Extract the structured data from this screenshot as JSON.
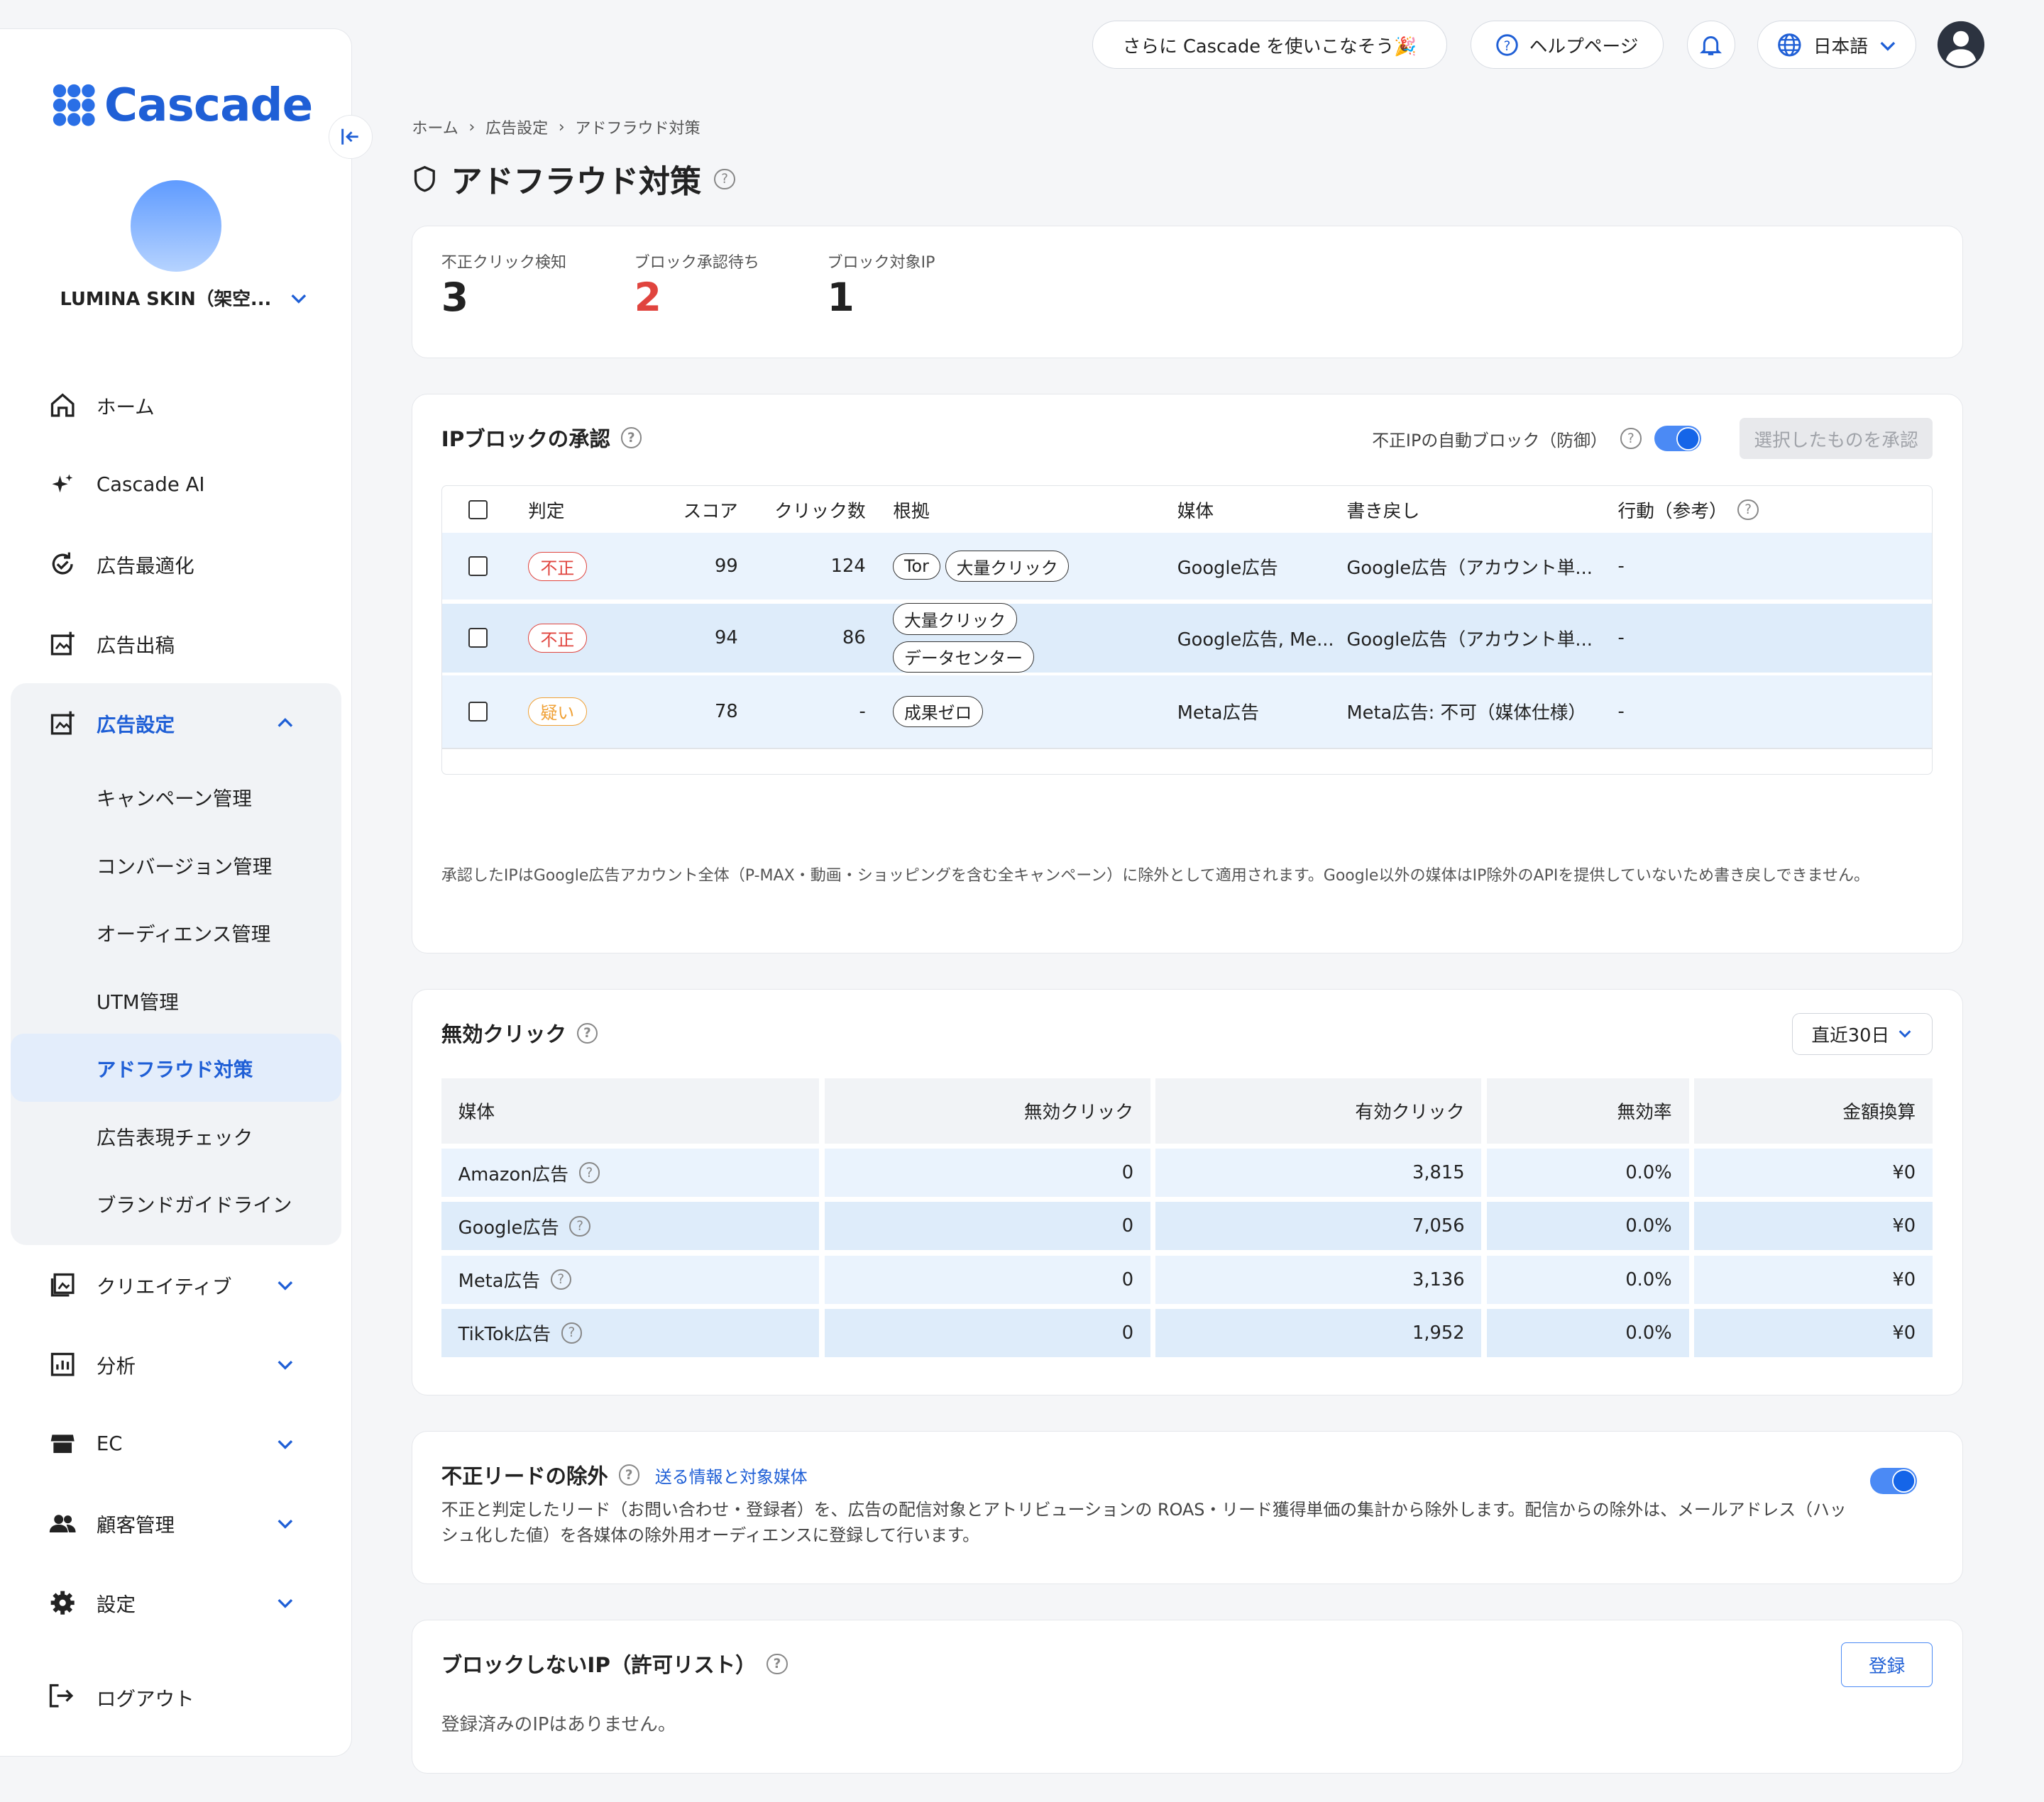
{
  "brand": {
    "name": "Cascade",
    "accent": "#1f5fd6"
  },
  "account": {
    "name": "LUMINA SKIN（架空..."
  },
  "topbar": {
    "promo": "さらに Cascade を使いこなそう🎉",
    "help": "ヘルプページ",
    "language": "日本語"
  },
  "nav": {
    "home": "ホーム",
    "ai": "Cascade AI",
    "optimize": "広告最適化",
    "publish": "広告出稿",
    "settings_group": "広告設定",
    "sub": [
      "キャンペーン管理",
      "コンバージョン管理",
      "オーディエンス管理",
      "UTM管理",
      "アドフラウド対策",
      "広告表現チェック",
      "ブランドガイドライン"
    ],
    "creative": "クリエイティブ",
    "analysis": "分析",
    "ec": "EC",
    "customers": "顧客管理",
    "settings": "設定",
    "logout": "ログアウト"
  },
  "breadcrumb": [
    "ホーム",
    "広告設定",
    "アドフラウド対策"
  ],
  "page_title": "アドフラウド対策",
  "stats": [
    {
      "label": "不正クリック検知",
      "value": "3",
      "color": "#222222"
    },
    {
      "label": "ブロック承認待ち",
      "value": "2",
      "color": "#e0443e"
    },
    {
      "label": "ブロック対象IP",
      "value": "1",
      "color": "#222222"
    }
  ],
  "ip_block": {
    "title": "IPブロックの承認",
    "auto_block_label": "不正IPの自動ブロック（防御）",
    "approve_button": "選択したものを承認",
    "columns": [
      "判定",
      "スコア",
      "クリック数",
      "根拠",
      "媒体",
      "書き戻し",
      "行動（参考）"
    ],
    "rows": [
      {
        "verdict": "不正",
        "verdict_type": "bad",
        "score": "99",
        "clicks": "124",
        "reasons": [
          "Tor",
          "大量クリック"
        ],
        "media": "Google広告",
        "writeback": "Google広告（アカウント単...",
        "action": "-"
      },
      {
        "verdict": "不正",
        "verdict_type": "bad",
        "score": "94",
        "clicks": "86",
        "reasons": [
          "大量クリック",
          "データセンター"
        ],
        "media": "Google広告, Me...",
        "writeback": "Google広告（アカウント単...",
        "action": "-"
      },
      {
        "verdict": "疑い",
        "verdict_type": "sus",
        "score": "78",
        "clicks": "-",
        "reasons": [
          "成果ゼロ"
        ],
        "media": "Meta広告",
        "writeback": "Meta広告: 不可（媒体仕様）",
        "action": "-"
      }
    ],
    "note": "承認したIPはGoogle広告アカウント全体（P-MAX・動画・ショッピングを含む全キャンペーン）に除外として適用されます。Google以外の媒体はIP除外のAPIを提供していないため書き戻しできません。"
  },
  "invalid_clicks": {
    "title": "無効クリック",
    "period": "直近30日",
    "columns": [
      "媒体",
      "無効クリック",
      "有効クリック",
      "無効率",
      "金額換算"
    ],
    "rows": [
      {
        "media": "Amazon広告",
        "invalid": "0",
        "valid": "3,815",
        "rate": "0.0%",
        "amount": "¥0"
      },
      {
        "media": "Google広告",
        "invalid": "0",
        "valid": "7,056",
        "rate": "0.0%",
        "amount": "¥0"
      },
      {
        "media": "Meta広告",
        "invalid": "0",
        "valid": "3,136",
        "rate": "0.0%",
        "amount": "¥0"
      },
      {
        "media": "TikTok広告",
        "invalid": "0",
        "valid": "1,952",
        "rate": "0.0%",
        "amount": "¥0"
      }
    ]
  },
  "fraud_leads": {
    "title": "不正リードの除外",
    "link": "送る情報と対象媒体",
    "body": "不正と判定したリード（お問い合わせ・登録者）を、広告の配信対象とアトリビューションの ROAS・リード獲得単価の集計から除外します。配信からの除外は、メールアドレス（ハッシュ化した値）を各媒体の除外用オーディエンスに登録して行います。"
  },
  "allowlist": {
    "title": "ブロックしないIP（許可リスト）",
    "register": "登録",
    "empty": "登録済みのIPはありません。"
  }
}
